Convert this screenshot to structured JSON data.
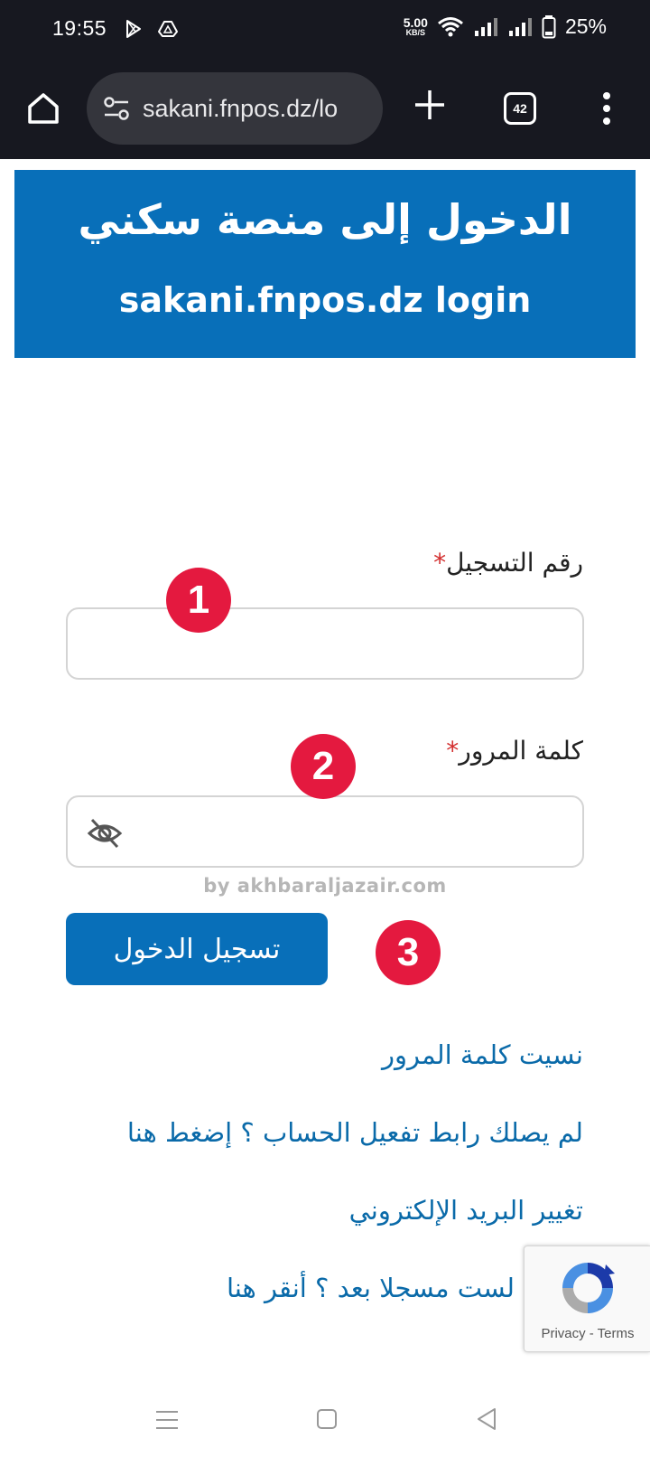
{
  "status_bar": {
    "time": "19:55",
    "net_speed_value": "5.00",
    "net_speed_unit": "KB/S",
    "battery": "25%"
  },
  "browser": {
    "url": "sakani.fnpos.dz/lo",
    "tab_count": "42"
  },
  "banner": {
    "title_ar": "الدخول إلى منصة سكني",
    "title_en": "sakani.fnpos.dz login",
    "bg_color": "#086fb9"
  },
  "form": {
    "registration_label": "رقم التسجيل",
    "password_label": "كلمة المرور",
    "required_mark": "*",
    "registration_value": "",
    "password_value": "",
    "login_button": "تسجيل الدخول"
  },
  "badges": [
    "1",
    "2",
    "3"
  ],
  "watermark": "by akhbaraljazair.com",
  "links": {
    "forgot_password": "نسيت كلمة المرور",
    "activation_link": "لم يصلك رابط تفعيل الحساب ؟ إضغط هنا",
    "change_email": "تغيير البريد الإلكتروني",
    "not_registered": "لست مسجلا بعد ؟ أنقر هنا"
  },
  "recaptcha": {
    "text": "Privacy - Terms"
  },
  "icons": [
    "home-icon",
    "tune-icon",
    "plus-icon",
    "more-vert-icon",
    "eye-off-icon",
    "recaptcha-icon",
    "nav-menu-icon",
    "nav-home-icon",
    "nav-back-icon"
  ]
}
